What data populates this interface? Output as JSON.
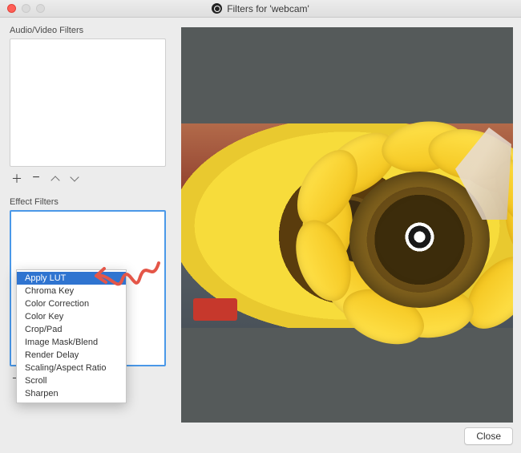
{
  "window": {
    "title": "Filters for 'webcam'"
  },
  "sections": {
    "audio_video": {
      "label": "Audio/Video Filters"
    },
    "effect": {
      "label": "Effect Filters"
    }
  },
  "toolbar": {
    "add": "+",
    "remove": "−",
    "move_up": "▲",
    "move_down": "▼"
  },
  "menu": {
    "items": [
      "Apply LUT",
      "Chroma Key",
      "Color Correction",
      "Color Key",
      "Crop/Pad",
      "Image Mask/Blend",
      "Render Delay",
      "Scaling/Aspect Ratio",
      "Scroll",
      "Sharpen"
    ],
    "selected_index": 0
  },
  "footer": {
    "close_label": "Close"
  }
}
